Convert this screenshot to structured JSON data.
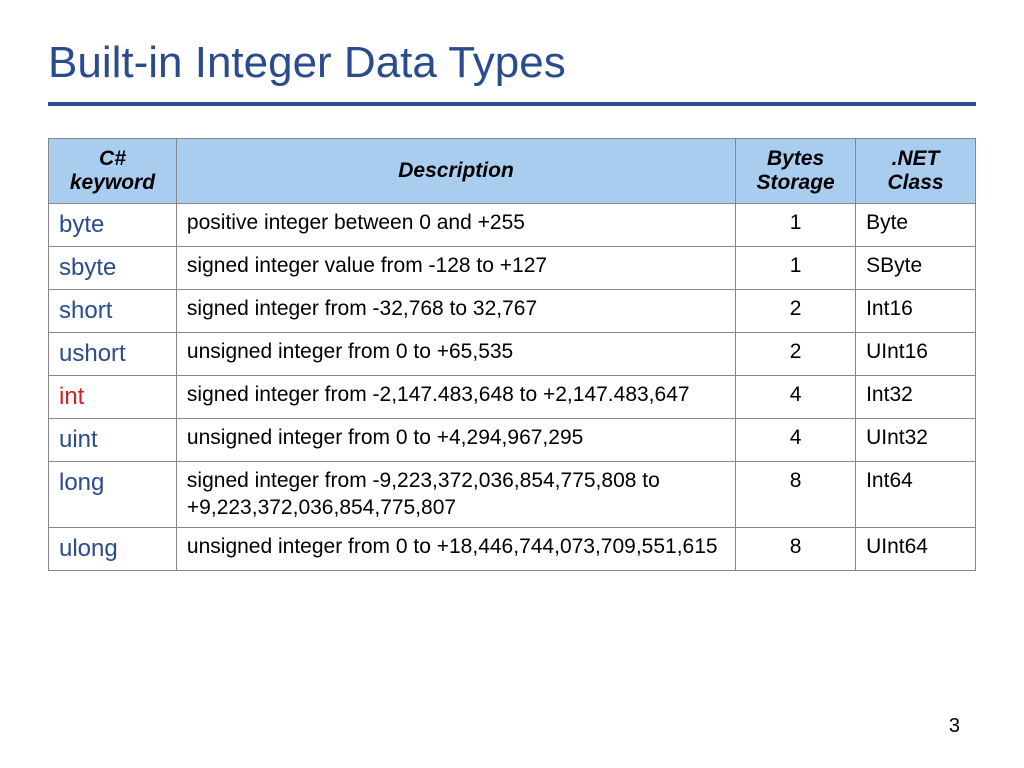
{
  "title": "Built-in Integer Data Types",
  "page_number": "3",
  "headers": {
    "keyword": "C# keyword",
    "description": "Description",
    "bytes": "Bytes Storage",
    "netclass": ".NET Class"
  },
  "rows": [
    {
      "keyword": "byte",
      "highlight": false,
      "description": "positive integer between 0 and +255",
      "bytes": "1",
      "netclass": "Byte"
    },
    {
      "keyword": "sbyte",
      "highlight": false,
      "description": "signed integer value from -128 to +127",
      "bytes": "1",
      "netclass": "SByte"
    },
    {
      "keyword": "short",
      "highlight": false,
      "description": "signed integer from -32,768 to 32,767",
      "bytes": "2",
      "netclass": "Int16"
    },
    {
      "keyword": "ushort",
      "highlight": false,
      "description": "unsigned integer from 0 to +65,535",
      "bytes": "2",
      "netclass": "UInt16"
    },
    {
      "keyword": "int",
      "highlight": true,
      "description": "signed integer from -2,147.483,648 to +2,147.483,647",
      "bytes": "4",
      "netclass": "Int32"
    },
    {
      "keyword": "uint",
      "highlight": false,
      "description": "unsigned integer from 0 to +4,294,967,295",
      "bytes": "4",
      "netclass": "UInt32"
    },
    {
      "keyword": "long",
      "highlight": false,
      "description": "signed integer from -9,223,372,036,854,775,808 to +9,223,372,036,854,775,807",
      "bytes": "8",
      "netclass": "Int64"
    },
    {
      "keyword": "ulong",
      "highlight": false,
      "description": "unsigned integer from 0 to +18,446,744,073,709,551,615",
      "bytes": "8",
      "netclass": "UInt64"
    }
  ]
}
